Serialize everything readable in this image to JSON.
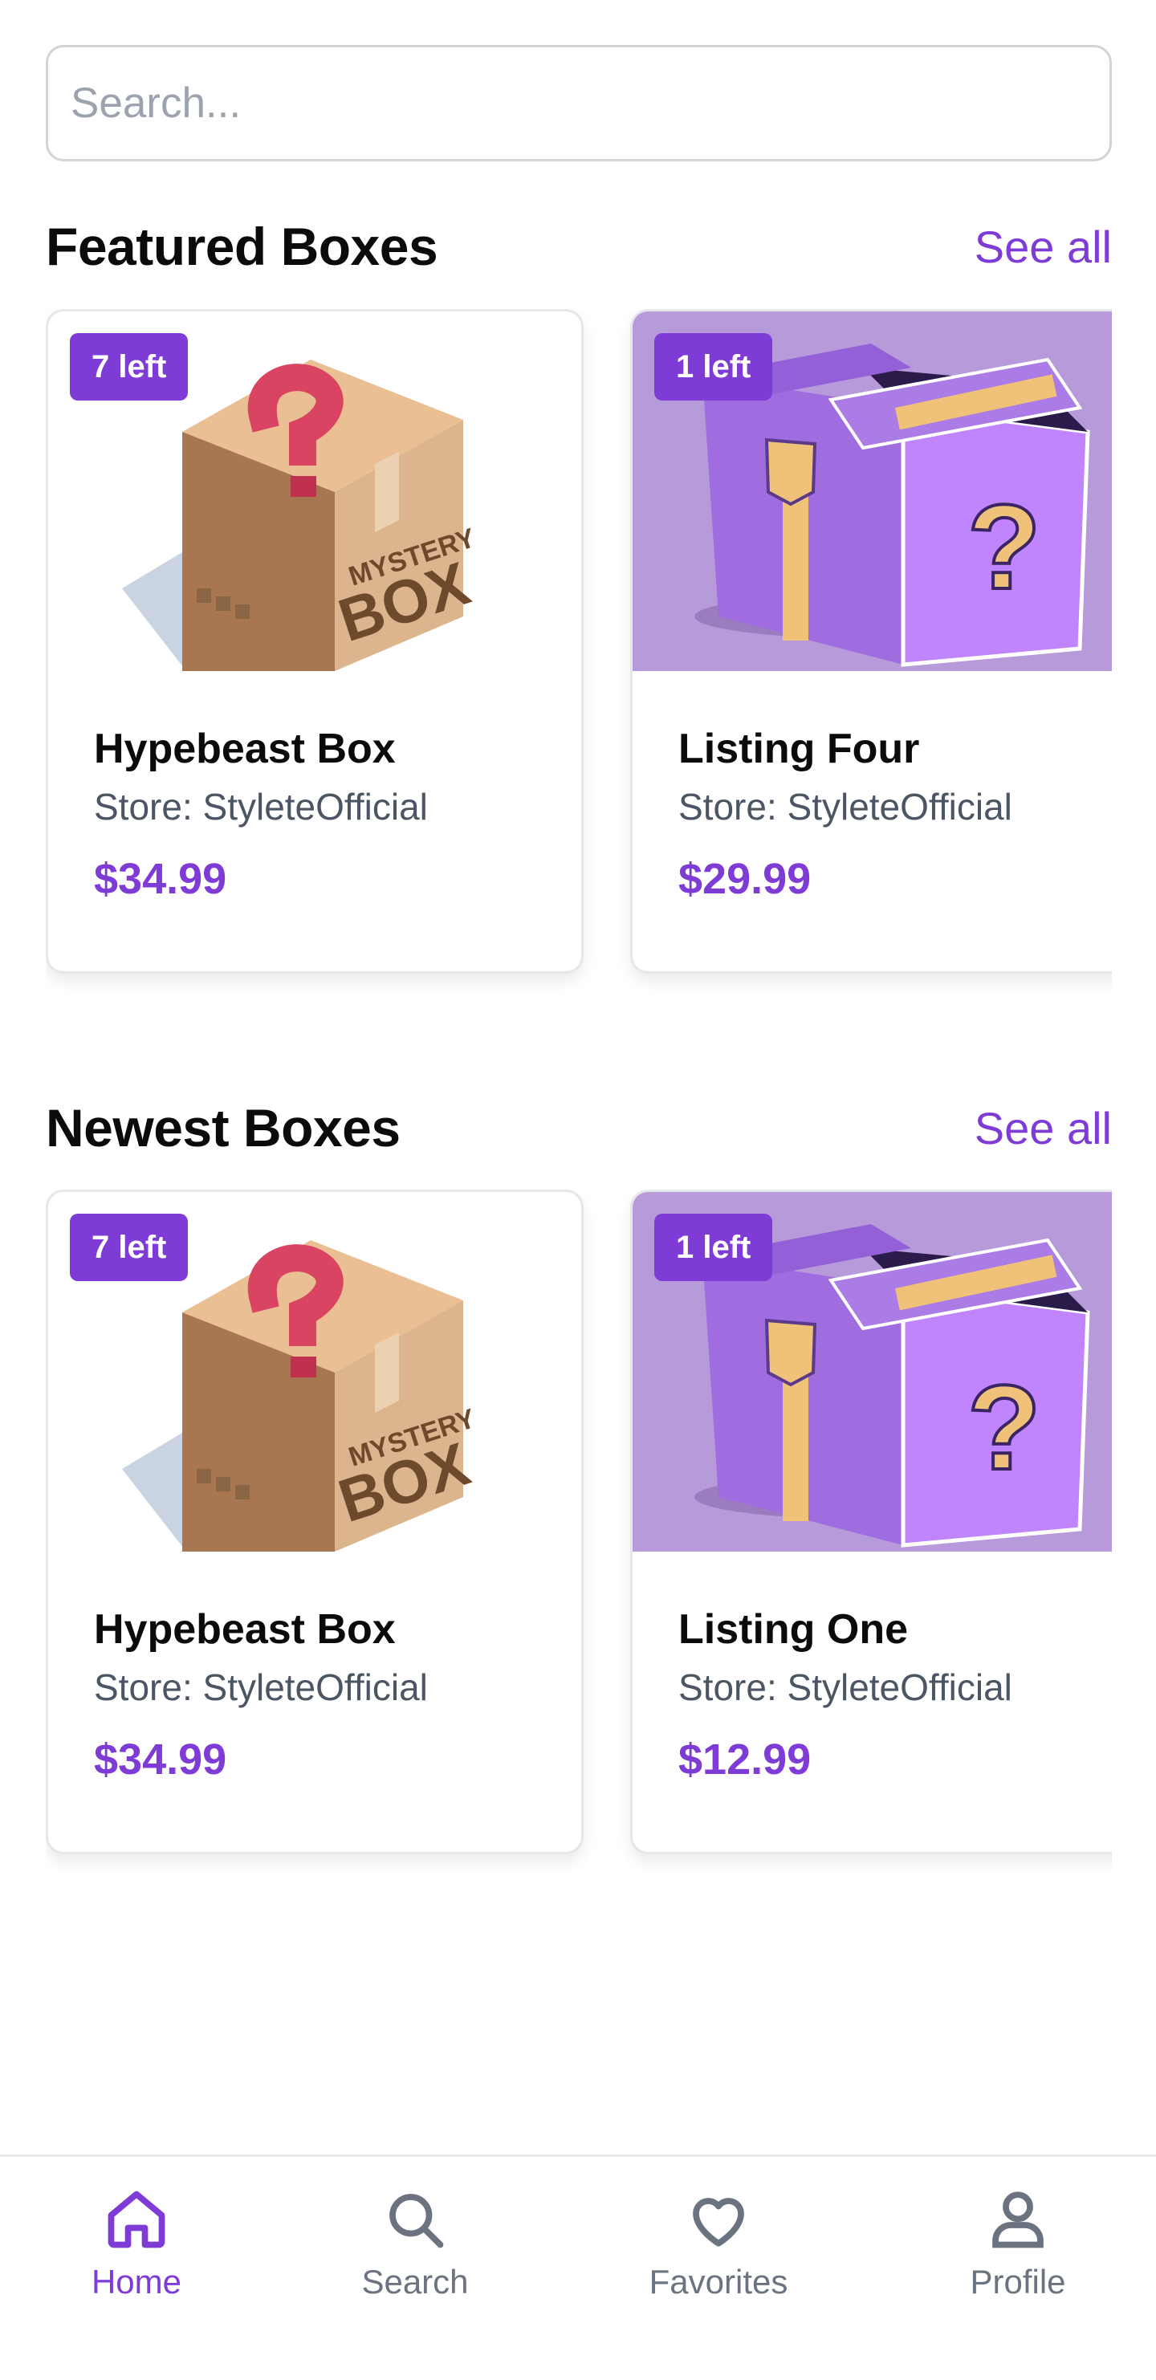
{
  "search": {
    "placeholder": "Search..."
  },
  "sections": [
    {
      "title": "Featured Boxes",
      "see_all": "See all",
      "cards": [
        {
          "badge": "7 left",
          "title": "Hypebeast Box",
          "store": "Store: StyleteOfficial",
          "price": "$34.99",
          "image": "cardboard-mystery-box",
          "box_lettering": [
            "MYSTERY",
            "BOX"
          ]
        },
        {
          "badge": "1 left",
          "title": "Listing Four",
          "store": "Store: StyleteOfficial",
          "price": "$29.99",
          "image": "purple-mystery-box"
        }
      ]
    },
    {
      "title": "Newest Boxes",
      "see_all": "See all",
      "cards": [
        {
          "badge": "7 left",
          "title": "Hypebeast Box",
          "store": "Store: StyleteOfficial",
          "price": "$34.99",
          "image": "cardboard-mystery-box",
          "box_lettering": [
            "MYSTERY",
            "BOX"
          ]
        },
        {
          "badge": "1 left",
          "title": "Listing One",
          "store": "Store: StyleteOfficial",
          "price": "$12.99",
          "image": "purple-mystery-box"
        }
      ]
    }
  ],
  "nav": {
    "items": [
      {
        "label": "Home",
        "icon": "home-icon",
        "active": true
      },
      {
        "label": "Search",
        "icon": "search-icon",
        "active": false
      },
      {
        "label": "Favorites",
        "icon": "heart-icon",
        "active": false
      },
      {
        "label": "Profile",
        "icon": "user-icon",
        "active": false
      }
    ]
  },
  "colors": {
    "accent": "#7e3bd6",
    "muted": "#6b7280",
    "border": "#e5e7eb",
    "purple_bg": "#b79ad9"
  }
}
